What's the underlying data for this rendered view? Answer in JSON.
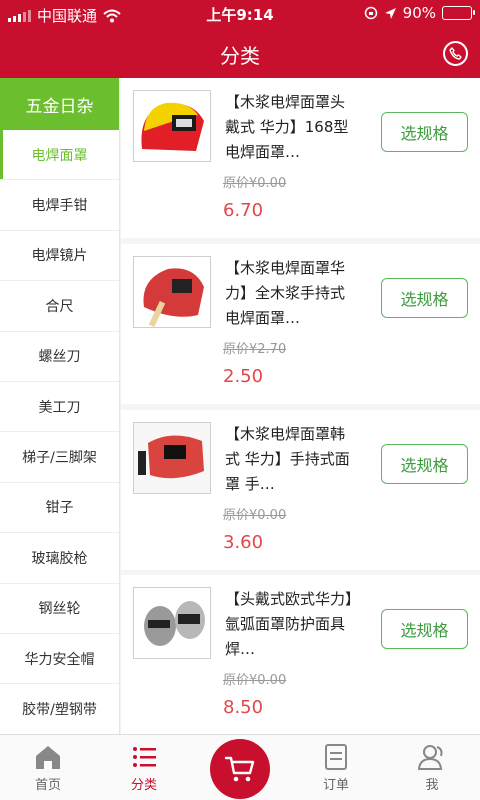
{
  "status_bar": {
    "carrier": "中国联通",
    "time": "上午9:14",
    "battery": "90%",
    "battery_level": 0.9
  },
  "header": {
    "title": "分类",
    "phone_icon": "phone-icon"
  },
  "sidebar": {
    "category": "五金日杂",
    "items": [
      {
        "label": "电焊面罩"
      },
      {
        "label": "电焊手钳"
      },
      {
        "label": "电焊镜片"
      },
      {
        "label": "合尺"
      },
      {
        "label": "螺丝刀"
      },
      {
        "label": "美工刀"
      },
      {
        "label": "梯子/三脚架"
      },
      {
        "label": "钳子"
      },
      {
        "label": "玻璃胶枪"
      },
      {
        "label": "钢丝轮"
      },
      {
        "label": "华力安全帽"
      },
      {
        "label": "胶带/塑钢带"
      }
    ],
    "active_index": 0
  },
  "products": [
    {
      "name": "【木浆电焊面罩头戴式 华力】168型电焊面罩…",
      "original_price": "原价¥0.00",
      "price": "6.70",
      "button": "选规格"
    },
    {
      "name": "【木浆电焊面罩华力】全木浆手持式电焊面罩…",
      "original_price": "原价¥2.70",
      "price": "2.50",
      "button": "选规格"
    },
    {
      "name": "【木浆电焊面罩韩式 华力】手持式面罩 手…",
      "original_price": "原价¥0.00",
      "price": "3.60",
      "button": "选规格"
    },
    {
      "name": "【头戴式欧式华力】氩弧面罩防护面具 焊…",
      "original_price": "原价¥0.00",
      "price": "8.50",
      "button": "选规格"
    }
  ],
  "tabs": [
    {
      "label": "首页",
      "icon": "home-icon"
    },
    {
      "label": "分类",
      "icon": "list-icon"
    },
    {
      "label": "",
      "icon": "cart-icon"
    },
    {
      "label": "订单",
      "icon": "order-icon"
    },
    {
      "label": "我",
      "icon": "user-icon"
    }
  ],
  "colors": {
    "brand_red": "#c8102e",
    "category_green": "#6bbf2e",
    "price_red": "#e2474b",
    "button_green": "#5cb85c"
  }
}
